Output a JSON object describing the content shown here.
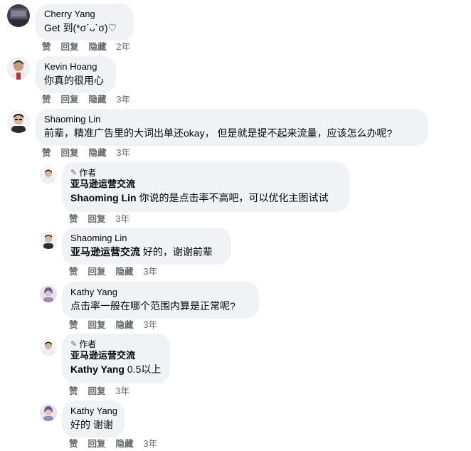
{
  "actions": {
    "like": "赞",
    "reply": "回复",
    "hide": "隐藏"
  },
  "comments": [
    {
      "name": "Cherry Yang",
      "text": "Get 到(*σ´ᴗ`σ)♡",
      "time": "2年"
    },
    {
      "name": "Kevin Hoang",
      "text": "你真的很用心",
      "time": "3年"
    },
    {
      "name": "Shaoming Lin",
      "text": "前辈，精准广告里的大词出单还okay， 但是就是提不起来流量，应该怎么办呢?",
      "time": "3年"
    },
    {
      "badge": "作者",
      "name": "亚马逊运营交流",
      "mention": "Shaoming Lin",
      "text": " 你说的是点击率不高吧，可以优化主图试试",
      "time": "3年"
    },
    {
      "name": "Shaoming Lin",
      "mention": "亚马逊运营交流",
      "text": " 好的，谢谢前辈",
      "time": "3年"
    },
    {
      "name": "Kathy Yang",
      "text": "点击率一般在哪个范围内算是正常呢?",
      "time": "3年"
    },
    {
      "badge": "作者",
      "name": "亚马逊运营交流",
      "mention": "Kathy Yang",
      "text": " 0.5以上",
      "time": "3年"
    },
    {
      "name": "Kathy Yang",
      "text": "好的 谢谢",
      "time": "3年"
    }
  ]
}
